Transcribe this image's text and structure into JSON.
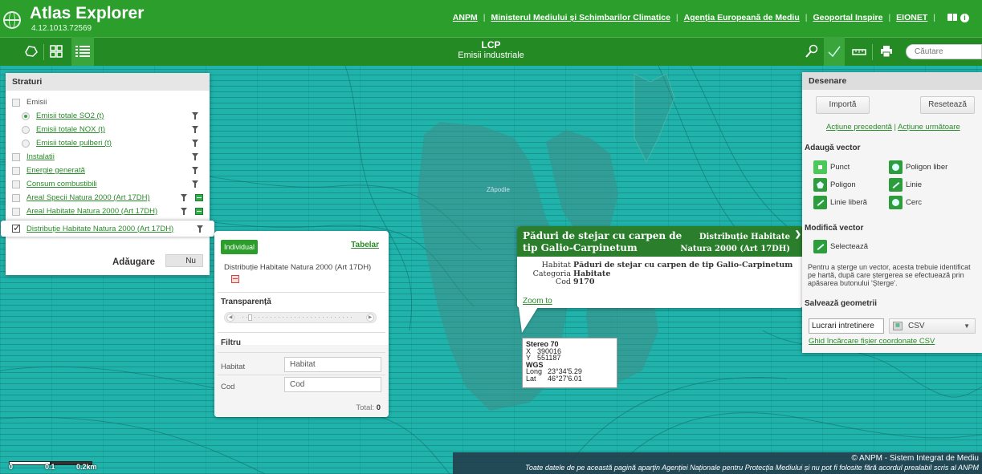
{
  "app": {
    "title": "Atlas Explorer",
    "version": "4.12.1013.72569"
  },
  "top_links": [
    "ANPM",
    "Ministerul Mediului și Schimbarilor Climatice",
    "Agenția Europeană de Mediu",
    "Geoportal Inspire",
    "EIONET"
  ],
  "toolbar": {
    "title": "LCP",
    "subtitle": "Emisii industriale",
    "search_placeholder": "Căutare"
  },
  "layers_panel": {
    "title": "Straturi",
    "items": [
      {
        "label": "Emisii",
        "kind": "checkbox",
        "checked": false
      },
      {
        "label": "Emisii totale SO2 (t)",
        "kind": "radio",
        "selected": true
      },
      {
        "label": "Emisii totale NOX (t)",
        "kind": "radio",
        "selected": false
      },
      {
        "label": "Emisii totale pulberi (t)",
        "kind": "radio",
        "selected": false
      },
      {
        "label": "Instalatii",
        "kind": "checkbox",
        "checked": false
      },
      {
        "label": "Energie generată",
        "kind": "checkbox",
        "checked": false
      },
      {
        "label": "Consum combustibili",
        "kind": "checkbox",
        "checked": false
      },
      {
        "label": "Areal Specii Natura 2000 (Art 17DH)",
        "kind": "checkbox",
        "checked": false
      },
      {
        "label": "Areal Habitate Natura 2000 (Art 17DH)",
        "kind": "checkbox",
        "checked": false
      },
      {
        "label": "Distribuție Habitate Natura 2000 (Art 17DH)",
        "kind": "checkbox",
        "checked": true
      }
    ],
    "add_label": "Adăugare",
    "add_toggle": "Nu"
  },
  "filter_popup": {
    "tab_individual": "Individual",
    "tab_table": "Tabelar",
    "layer_name": "Distribuție Habitate Natura 2000 (Art 17DH)",
    "transparency_label": "Transparență",
    "transparency_value": 0.05,
    "filter_label": "Filtru",
    "field1_label": "Habitat",
    "field1_value": "Habitat",
    "field2_label": "Cod",
    "field2_value": "Cod",
    "total_label": "Total:",
    "total_value": "0"
  },
  "identify": {
    "title": "Păduri de stejar cu carpen de tip Galio-Carpinetum",
    "layer": "Distribuție Habitate Natura 2000 (Art 17DH)",
    "layer_line1": "Distribuție Habitate",
    "layer_line2": "Natura 2000 (Art 17DH)",
    "rows": [
      {
        "key": "Habitat",
        "value": "Păduri de stejar cu carpen de tip Galio-Carpinetum"
      },
      {
        "key": "Categoria",
        "value": "Habitate"
      },
      {
        "key": "Cod",
        "value": "9170"
      }
    ],
    "zoom_label": "Zoom to"
  },
  "coords": {
    "sys1": "Stereo 70",
    "x_label": "X",
    "x_value": "390016",
    "y_label": "Y",
    "y_value": "551187",
    "sys2": "WGS",
    "long_label": "Long",
    "long_value": "23°34'5.29",
    "lat_label": "Lat",
    "lat_value": "46°27'6.01"
  },
  "map": {
    "place_label": "Zăpodie"
  },
  "draw_panel": {
    "title": "Desenare",
    "import_label": "Importă",
    "reset_label": "Resetează",
    "prev_action": "Acțiune precedentă",
    "next_action": "Acțiune următoare",
    "add_vector_title": "Adaugă vector",
    "tools": [
      "Punct",
      "Poligon liber",
      "Poligon",
      "Linie",
      "Linie liberă",
      "Cerc"
    ],
    "modify_title": "Modifică vector",
    "select_label": "Selectează",
    "note": "Pentru a șterge un vector, acesta trebuie identificat pe hartă, după care ștergerea se efectuează prin apăsarea butonului 'Șterge'.",
    "save_title": "Salvează geometrii",
    "save_name": "Lucrari intretinere",
    "format": "CSV",
    "guide_link": "Ghid încărcare fișier coordonate CSV"
  },
  "footer": {
    "line1": "© ANPM - Sistem Integrat de Mediu",
    "line2": "Toate datele de pe această pagină aparțin Agenției Naționale pentru Protecția Mediului și nu pot fi folosite fără acordul prealabil scris al ANPM"
  },
  "scale": {
    "t0": "0",
    "t1": "0.1",
    "t2": "0.2km"
  },
  "colors": {
    "header": "#2b9e2b",
    "map_base": "#1fb3ab",
    "link": "#2b8a2b"
  }
}
